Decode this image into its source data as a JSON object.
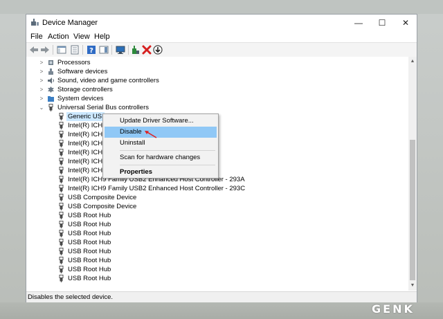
{
  "window": {
    "title": "Device Manager"
  },
  "caption": {
    "minimize": "—",
    "maximize": "☐",
    "close": "✕"
  },
  "menu": [
    "File",
    "Action",
    "View",
    "Help"
  ],
  "tree": {
    "categories_top": [
      "Processors",
      "Software devices",
      "Sound, video and game controllers",
      "Storage controllers",
      "System devices"
    ],
    "usb_category": "Universal Serial Bus controllers",
    "usb_devices": [
      "Generic USB",
      "Intel(R) ICH9",
      "Intel(R) ICH9",
      "Intel(R) ICH9",
      "Intel(R) ICH9",
      "Intel(R) ICH9",
      "Intel(R) ICH9",
      "Intel(R) ICH9 Family USB2 Enhanced Host Controller - 293A",
      "Intel(R) ICH9 Family USB2 Enhanced Host Controller - 293C",
      "USB Composite Device",
      "USB Composite Device",
      "USB Root Hub",
      "USB Root Hub",
      "USB Root Hub",
      "USB Root Hub",
      "USB Root Hub",
      "USB Root Hub",
      "USB Root Hub",
      "USB Root Hub"
    ]
  },
  "context_menu": {
    "update": "Update Driver Software...",
    "disable": "Disable",
    "uninstall": "Uninstall",
    "scan": "Scan for hardware changes",
    "properties": "Properties"
  },
  "status": {
    "text": "Disables the selected device."
  },
  "watermark": {
    "text": "GENK"
  },
  "colors": {
    "highlight": "#90c8f6",
    "selection": "#cce8ff",
    "disable_x": "#d61f1f"
  }
}
